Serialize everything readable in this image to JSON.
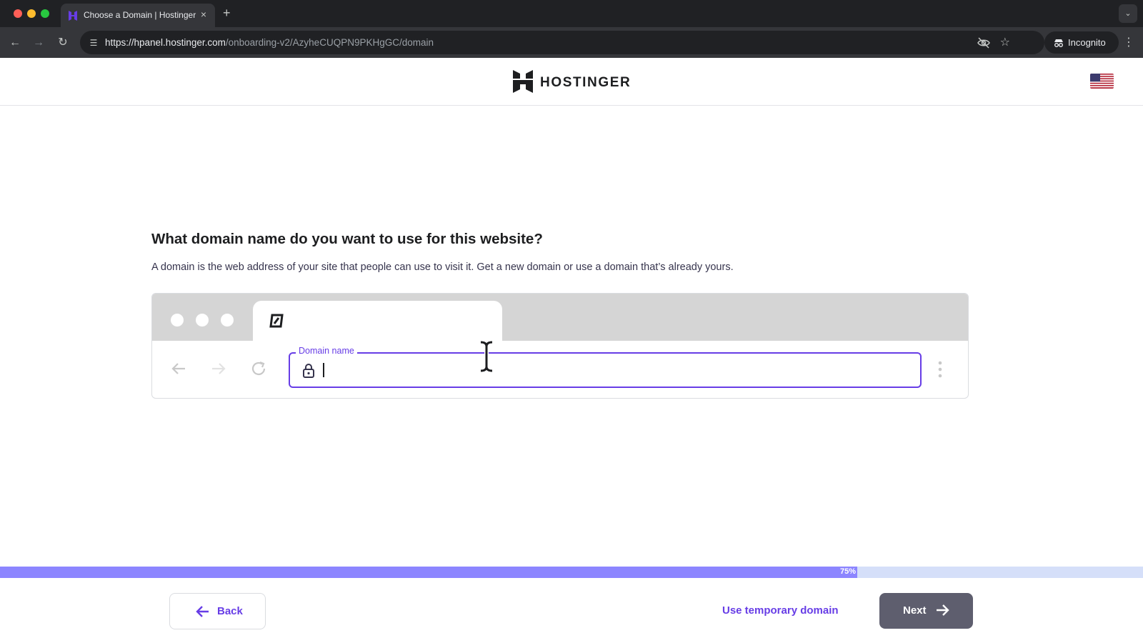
{
  "browser": {
    "tab_title": "Choose a Domain | Hostinger",
    "tab_close": "×",
    "new_tab": "+",
    "url_host": "https://hpanel.hostinger.com",
    "url_path": "/onboarding-v2/AzyheCUQPN9PKHgGC/domain",
    "incognito_label": "Incognito",
    "icons": [
      "back-icon",
      "forward-icon",
      "reload-icon",
      "site-info-icon",
      "eye-off-icon",
      "star-icon",
      "incognito-icon",
      "menu-icon"
    ]
  },
  "header": {
    "brand": "HOSTINGER",
    "language_flag": "us-flag-icon"
  },
  "main": {
    "question": "What domain name do you want to use for this website?",
    "description": "A domain is the web address of your site that people can use to visit it. Get a new domain or use a domain that’s already yours.",
    "domain_field": {
      "label": "Domain name",
      "value": "",
      "placeholder": ""
    }
  },
  "progress": {
    "percent": 75,
    "label": "75%"
  },
  "footer": {
    "back_label": "Back",
    "temp_domain_label": "Use temporary domain",
    "next_label": "Next"
  },
  "colors": {
    "accent": "#673de6",
    "progress_fill": "#8c85ff",
    "progress_track": "#d5dff9",
    "next_button": "#5e5e6e"
  }
}
